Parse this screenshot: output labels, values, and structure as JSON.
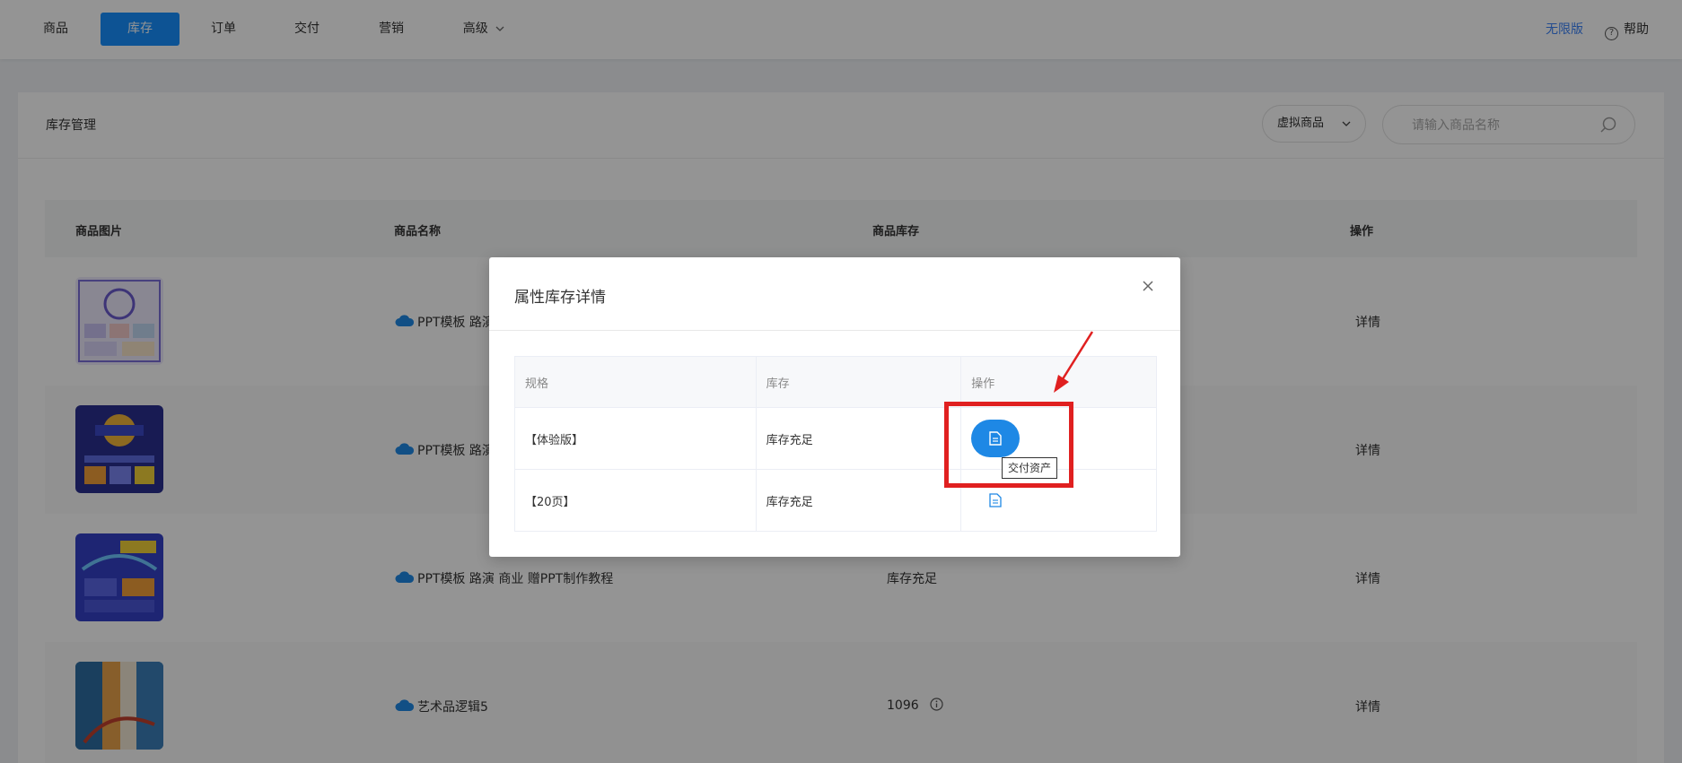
{
  "nav": {
    "items": [
      {
        "label": "商品",
        "active": false
      },
      {
        "label": "库存",
        "active": true
      },
      {
        "label": "订单",
        "active": false
      },
      {
        "label": "交付",
        "active": false
      },
      {
        "label": "营销",
        "active": false
      },
      {
        "label": "高级",
        "active": false,
        "has_dropdown": true
      }
    ],
    "plan_label": "无限版",
    "help_label": "帮助",
    "accent_color": "#1890ff",
    "plan_color": "#3b82f6"
  },
  "panel": {
    "title": "库存管理",
    "type_filter": "虚拟商品",
    "search_placeholder": "请输入商品名称"
  },
  "table": {
    "headers": [
      "商品图片",
      "商品名称",
      "商品库存",
      "操作"
    ],
    "rows": [
      {
        "name": "PPT模板 路演",
        "stock": "",
        "action": "详情",
        "icon": "cloud-icon"
      },
      {
        "name": "PPT模板 路演",
        "stock": "",
        "action": "详情",
        "icon": "cloud-icon"
      },
      {
        "name": "PPT模板 路演 商业 赠PPT制作教程",
        "stock": "库存充足",
        "action": "详情",
        "icon": "cloud-icon"
      },
      {
        "name": "艺术品逻辑5",
        "stock": "1096",
        "action": "详情",
        "icon": "cloud-icon"
      }
    ]
  },
  "modal": {
    "title": "属性库存详情",
    "headers": [
      "规格",
      "库存",
      "操作"
    ],
    "rows": [
      {
        "spec": "【体验版】",
        "stock": "库存充足"
      },
      {
        "spec": "【20页】",
        "stock": "库存充足"
      }
    ],
    "tooltip": "交付资产",
    "button_color": "#1e88e5",
    "annotation_color": "#e02020"
  }
}
